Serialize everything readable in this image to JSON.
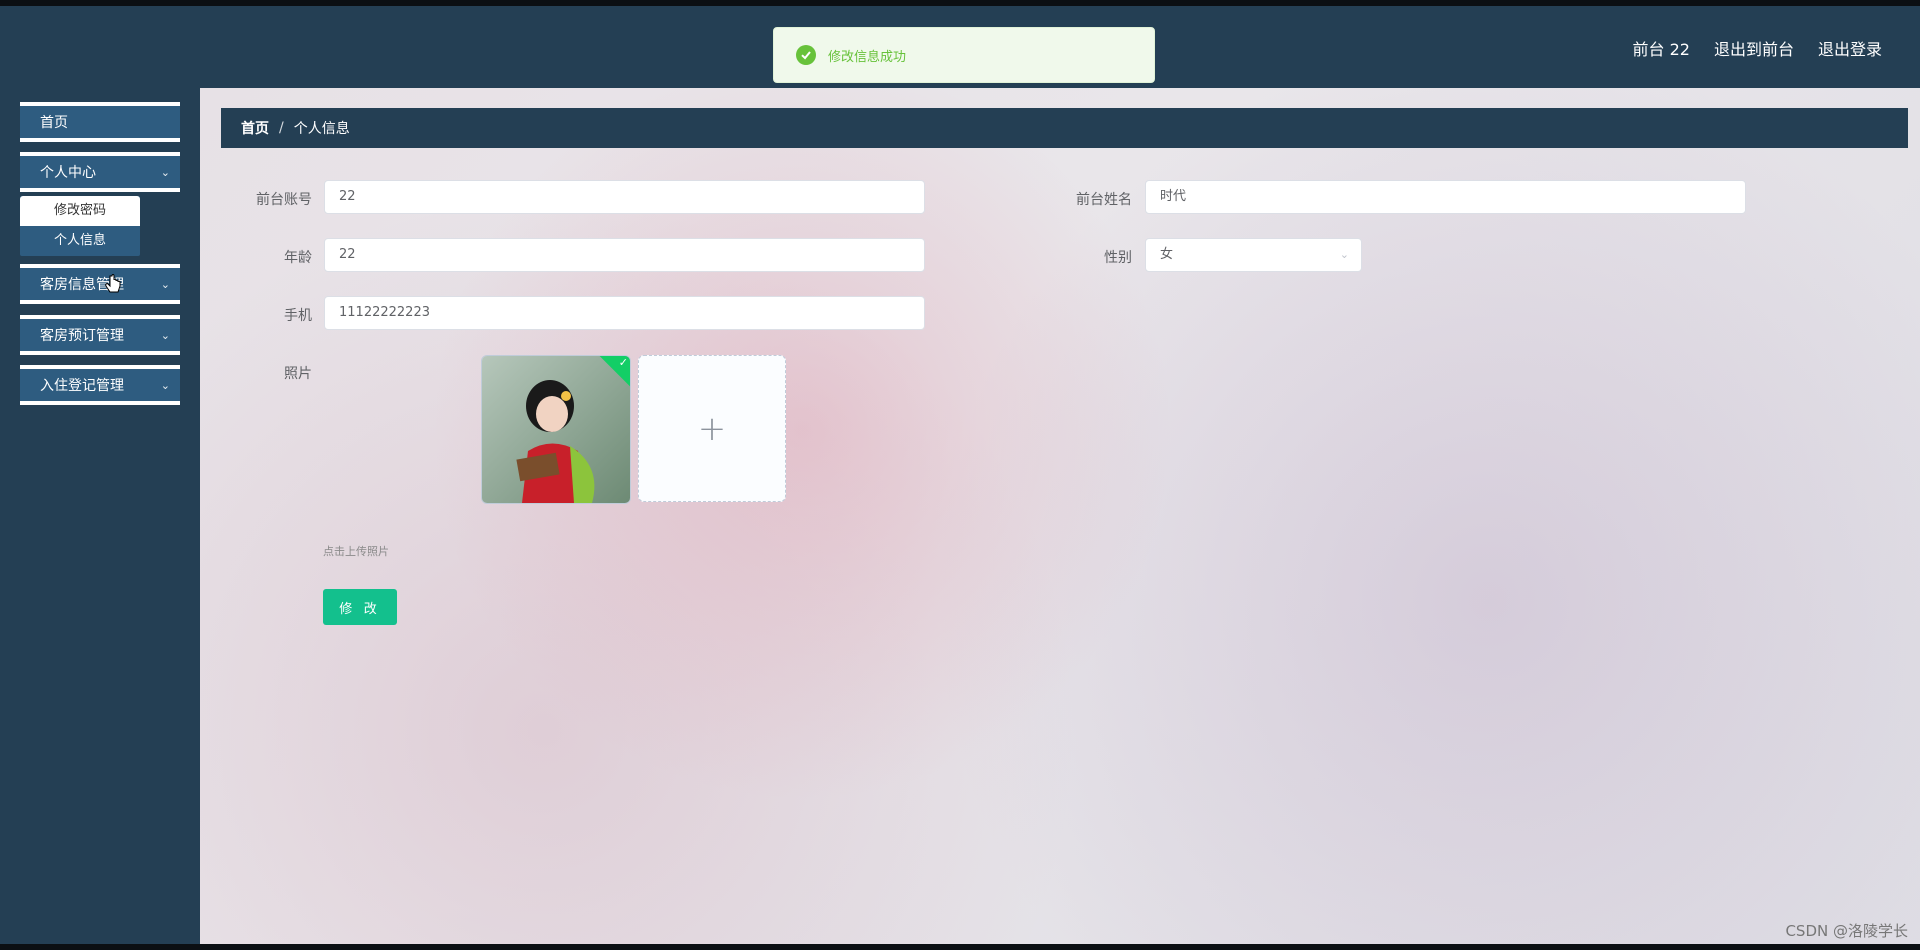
{
  "header": {
    "user_label": "前台 22",
    "exit_front_label": "退出到前台",
    "logout_label": "退出登录"
  },
  "toast": {
    "message": "修改信息成功"
  },
  "sidebar": {
    "items": [
      {
        "label": "首页"
      },
      {
        "label": "个人中心",
        "submenu": [
          "修改密码",
          "个人信息"
        ]
      },
      {
        "label": "客房信息管理"
      },
      {
        "label": "客房预订管理"
      },
      {
        "label": "入住登记管理"
      }
    ]
  },
  "breadcrumb": {
    "home": "首页",
    "separator": "/",
    "current": "个人信息"
  },
  "form": {
    "account_label": "前台账号",
    "account_value": "22",
    "name_label": "前台姓名",
    "name_value": "时代",
    "age_label": "年龄",
    "age_value": "22",
    "gender_label": "性别",
    "gender_value": "女",
    "phone_label": "手机",
    "phone_value": "11122222223",
    "photo_label": "照片",
    "upload_tip": "点击上传照片",
    "submit_label": "修 改"
  },
  "watermark": "CSDN @洛陵学长",
  "colors": {
    "header_bg": "#243f54",
    "menu_bg": "#2e5c80",
    "success": "#67c23a",
    "submit": "#13c08d"
  }
}
